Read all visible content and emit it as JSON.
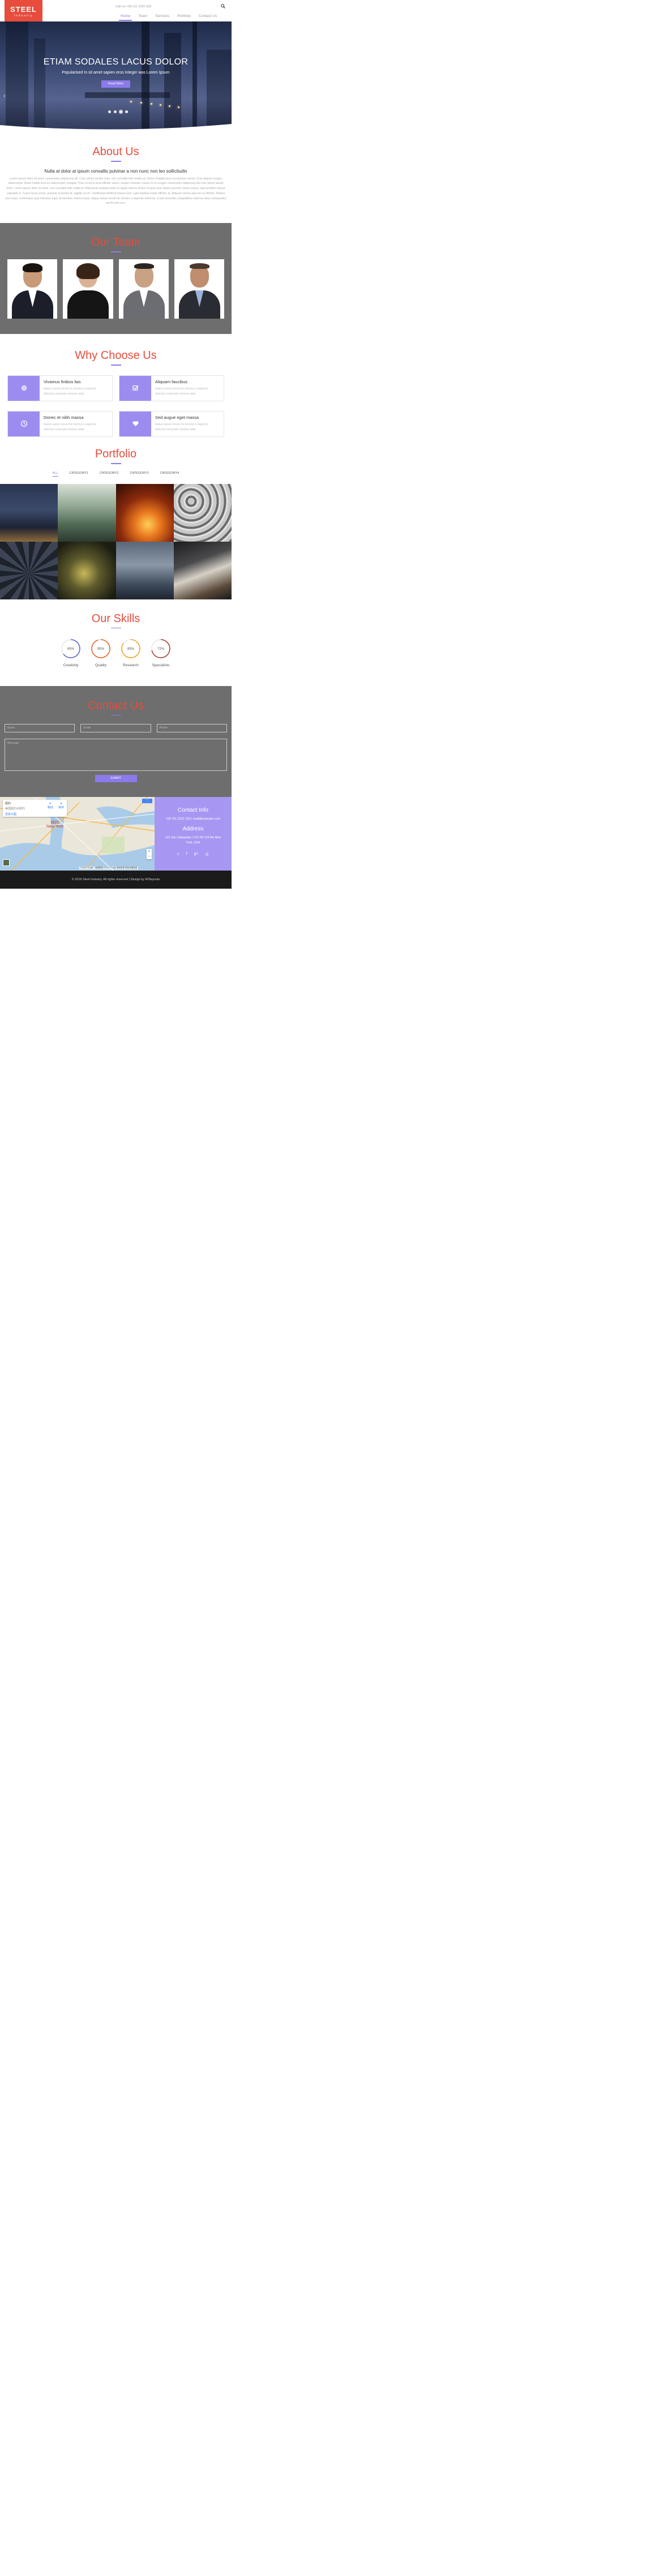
{
  "header": {
    "logo_title": "STEEL",
    "logo_sub": "Industry",
    "callus": "Call Us +00 111 2222 333",
    "nav": [
      "Home",
      "Team",
      "Services",
      "Portfolio",
      "Contact Us"
    ]
  },
  "hero": {
    "title": "ETIAM SODALES LACUS DOLOR",
    "subtitle": "Popularised In sit amet sapien eros Integer was Lorem Ipsum",
    "button": "Read More"
  },
  "about": {
    "title": "About Us",
    "lead": "Nulla at dolor at ipsum convallis pulvinar a non nunc non leo sollicitudin",
    "text": "Lorem ipsum dolor sit amet, consectetur adipiscing elit. Cras rutrum iaculis enim, non convallis felis mattis at. Donec fringilla lacus eu pretium rutrum. Cras aliquet congue ullamcorper. Etiam mattis eros eu ullamcorper volutpat. Proin ut dui a urna efficitur varius. uisque molestie cursus mi et congue consectetur adipiscing elit cras rutrum iaculis enim, Lorem ipsum dolor sit amet, non convallis felis mattis at. Maecenas sodales tortor ac ligula ultrices dictum et quis urna. Etiam pulvinar metus neque, eget porttitor massa vulputate in. Fusce lacus purus, pulvinar ut lacinia id, sagittis eu mi. Vestibulum eleifend massa sem, eget dapibus turpis efficitur at. Aliquam viverra quis leo et efficitur. Nullam arcu risus, scelerisque quis interdum eget, fermentum viverra turpis. Itaque earum rerum hic tenetur a sapiente delectus, ut aut reiciendis voluptatibus maiores alias consequatur aut At vero eos."
  },
  "team": {
    "title": "Our Team"
  },
  "why": {
    "title": "Why Choose Us",
    "cards": [
      {
        "icon": "gear-icon",
        "title": "Vivamus finibus lias",
        "desc1": "Itaque earum rerum hic tenetur a sapiente",
        "desc2": "delectus reiciendis maiores alias"
      },
      {
        "icon": "check-icon",
        "title": "Aliquam faucibus",
        "desc1": "Itaque earum rerum hic tenetur a sapiente",
        "desc2": "delectus reiciendis maiores alias"
      },
      {
        "icon": "clock-icon",
        "title": "Donec et nibh massa",
        "desc1": "Itaque earum rerum hic tenetur a sapiente",
        "desc2": "delectus reiciendis maiores alias"
      },
      {
        "icon": "heart-icon",
        "title": "Sed augue eget massa",
        "desc1": "Itaque earum rerum hic tenetur a sapiente",
        "desc2": "delectus reiciendis maiores alias"
      }
    ]
  },
  "portfolio": {
    "title": "Portfolio",
    "filters": [
      "ALL",
      "CATEGORY1",
      "CATEGORY2",
      "CATEGORY3",
      "CATEGORY4"
    ]
  },
  "skills": {
    "title": "Our Skills",
    "items": [
      {
        "label": "Creativity",
        "percent": "65%",
        "value": 0.65,
        "color": "#5b5fd1"
      },
      {
        "label": "Quality",
        "percent": "95%",
        "value": 0.95,
        "color": "#e8601f"
      },
      {
        "label": "Research",
        "percent": "85%",
        "value": 0.85,
        "color": "#f0a01f"
      },
      {
        "label": "Specialists",
        "percent": "72%",
        "value": 0.72,
        "color": "#a8382b"
      }
    ]
  },
  "contact": {
    "title": "Contact Us",
    "name_ph": "Name",
    "email_ph": "Email",
    "phone_ph": "Phone",
    "message_ph": "Message",
    "submit": "SUBMIT"
  },
  "map": {
    "place": "纽约",
    "place_sub": "美国纽约州纽约",
    "view_larger": "查看大图",
    "route": "路线",
    "save": "保存",
    "city_cn": "纽约",
    "city_en": "New York",
    "footer": "©2016 Google - 地图数据 ©2016 Google 使用条款 报告地图错误"
  },
  "info": {
    "title": "Contact Info",
    "phone_email": "+00 111 2222 333 | mail@example.com",
    "address_title": "Address",
    "address": "121 San Sebastian | CG 09-123 Ba New York, USA"
  },
  "footer": {
    "copyright": "© 2016 Steel Industry. All rights reserved | Design by W3layouts"
  },
  "colors": {
    "accent": "#e74c3c",
    "purple": "#8b7bea",
    "grey": "#6e6e6e"
  }
}
